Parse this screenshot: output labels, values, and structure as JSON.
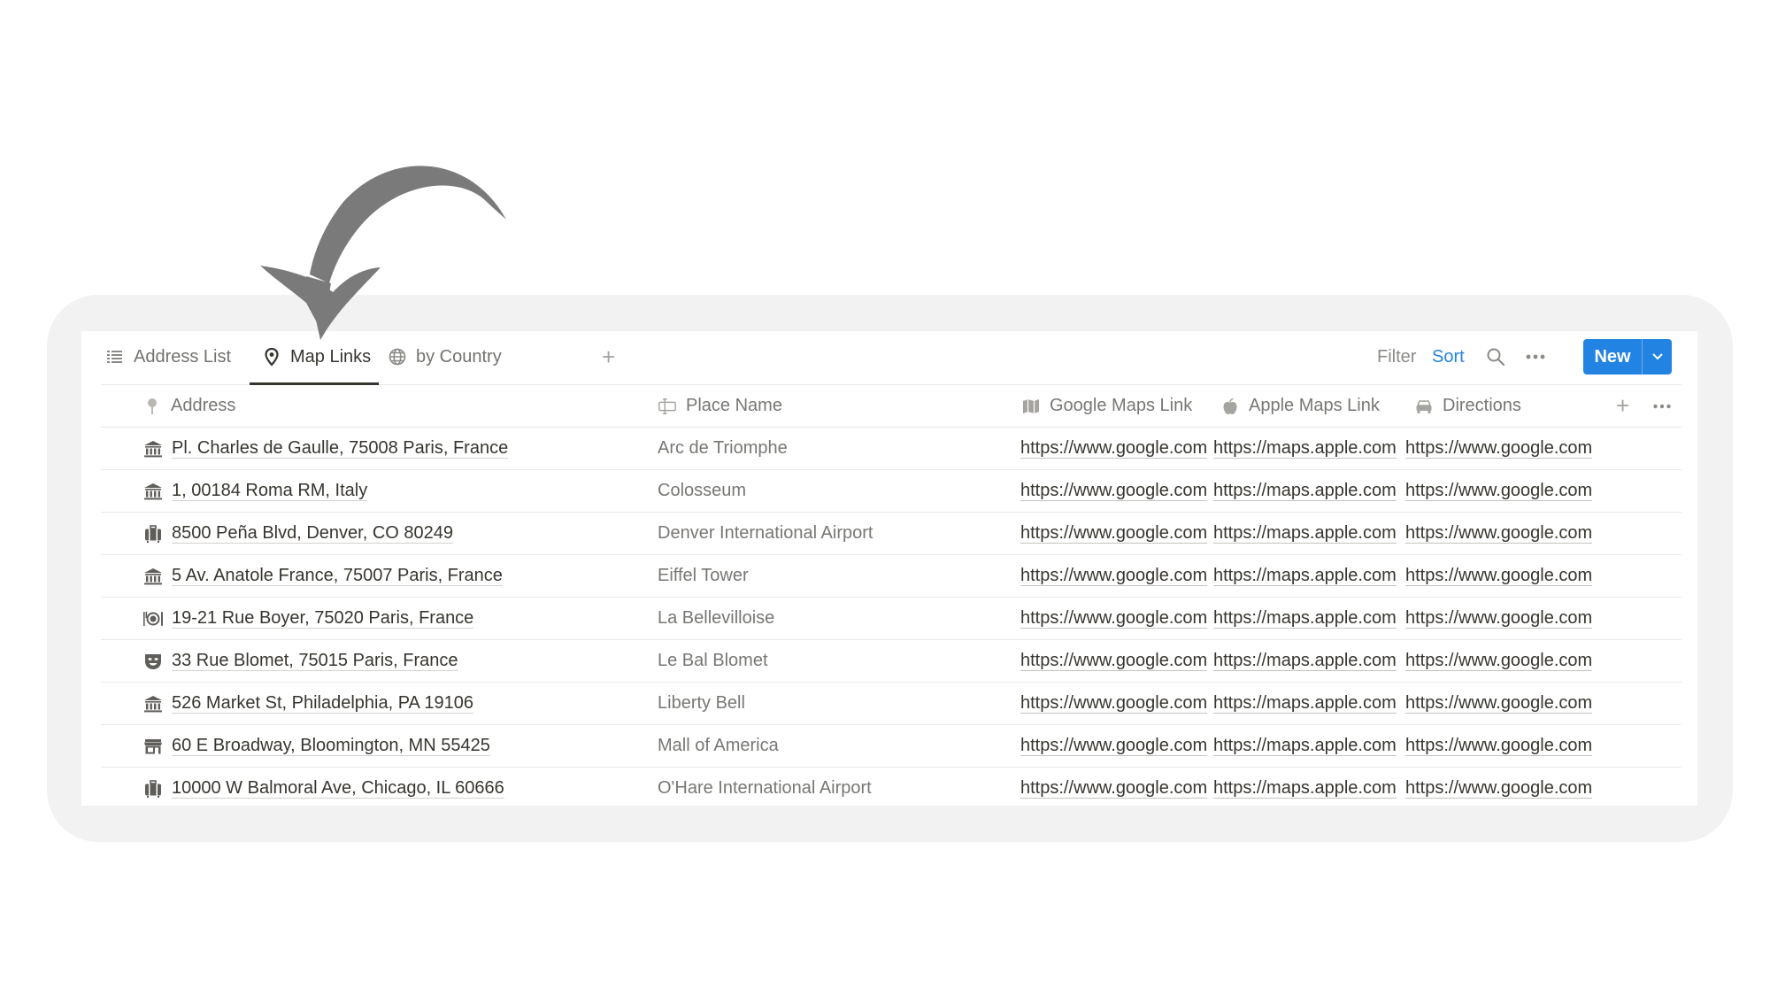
{
  "tabs": [
    {
      "label": "Address List",
      "icon": "list-icon",
      "active": false
    },
    {
      "label": "Map Links",
      "icon": "map-pin-icon",
      "active": true
    },
    {
      "label": "by Country",
      "icon": "globe-icon",
      "active": false
    }
  ],
  "add_view": "+",
  "toolbar": {
    "filter_label": "Filter",
    "sort_label": "Sort",
    "new_label": "New",
    "accent_color": "#2383e2"
  },
  "columns": [
    {
      "label": "Address",
      "icon": "pin-icon"
    },
    {
      "label": "Place Name",
      "icon": "text-cursor-icon"
    },
    {
      "label": "Google Maps Link",
      "icon": "map-icon"
    },
    {
      "label": "Apple Maps Link",
      "icon": "apple-icon"
    },
    {
      "label": "Directions",
      "icon": "car-icon"
    }
  ],
  "add_column": "+",
  "rows": [
    {
      "icon": "museum-icon",
      "address": "Pl. Charles de Gaulle, 75008 Paris, France",
      "place": "Arc de Triomphe",
      "google": "https://www.google.com",
      "apple": "https://maps.apple.com",
      "directions": "https://www.google.com"
    },
    {
      "icon": "museum-icon",
      "address": "1, 00184 Roma RM, Italy",
      "place": "Colosseum",
      "google": "https://www.google.com",
      "apple": "https://maps.apple.com",
      "directions": "https://www.google.com"
    },
    {
      "icon": "luggage-icon",
      "address": "8500 Peña Blvd, Denver, CO 80249",
      "place": "Denver International Airport",
      "google": "https://www.google.com",
      "apple": "https://maps.apple.com",
      "directions": "https://www.google.com"
    },
    {
      "icon": "museum-icon",
      "address": "5 Av. Anatole France, 75007 Paris, France",
      "place": "Eiffel Tower",
      "google": "https://www.google.com",
      "apple": "https://maps.apple.com",
      "directions": "https://www.google.com"
    },
    {
      "icon": "dining-icon",
      "address": "19-21 Rue Boyer, 75020 Paris, France",
      "place": "La Bellevilloise",
      "google": "https://www.google.com",
      "apple": "https://maps.apple.com",
      "directions": "https://www.google.com"
    },
    {
      "icon": "theater-mask-icon",
      "address": "33 Rue Blomet, 75015 Paris, France",
      "place": "Le Bal Blomet",
      "google": "https://www.google.com",
      "apple": "https://maps.apple.com",
      "directions": "https://www.google.com"
    },
    {
      "icon": "museum-icon",
      "address": "526 Market St, Philadelphia, PA 19106",
      "place": "Liberty Bell",
      "google": "https://www.google.com",
      "apple": "https://maps.apple.com",
      "directions": "https://www.google.com"
    },
    {
      "icon": "storefront-icon",
      "address": "60 E Broadway, Bloomington, MN 55425",
      "place": "Mall of America",
      "google": "https://www.google.com",
      "apple": "https://maps.apple.com",
      "directions": "https://www.google.com"
    },
    {
      "icon": "luggage-icon",
      "address": "10000 W Balmoral Ave, Chicago, IL 60666",
      "place": "O'Hare International Airport",
      "google": "https://www.google.com",
      "apple": "https://maps.apple.com",
      "directions": "https://www.google.com"
    }
  ]
}
